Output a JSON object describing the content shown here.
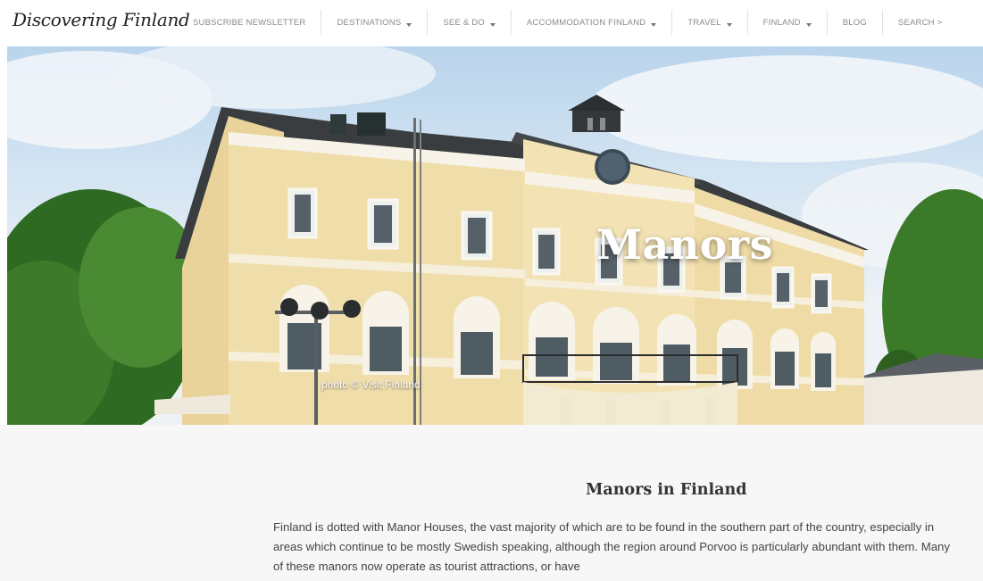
{
  "header": {
    "logo": "Discovering Finland",
    "nav": [
      {
        "label": "SUBSCRIBE NEWSLETTER",
        "dropdown": false
      },
      {
        "label": "DESTINATIONS",
        "dropdown": true
      },
      {
        "label": "SEE & DO",
        "dropdown": true
      },
      {
        "label": "ACCOMMODATION FINLAND",
        "dropdown": true
      },
      {
        "label": "TRAVEL",
        "dropdown": true
      },
      {
        "label": "FINLAND",
        "dropdown": true
      },
      {
        "label": "BLOG",
        "dropdown": false
      },
      {
        "label": "SEARCH >",
        "dropdown": false
      }
    ]
  },
  "hero": {
    "title": "Manors",
    "photo_credit": "photo © Visit Finland"
  },
  "article": {
    "heading": "Manors in Finland",
    "body": "Finland is dotted with Manor Houses, the vast majority of which are to be found in the southern part of the country, especially in areas which continue to be mostly Swedish speaking, although the region around Porvoo is particularly abundant with them. Many of these manors now operate as tourist attractions, or have"
  },
  "colors": {
    "facade": "#f0deaa",
    "trim": "#f6f3ea",
    "roof": "#3a3d40",
    "trees": "#3f7a2a",
    "content_bg": "#f7f7f7"
  }
}
